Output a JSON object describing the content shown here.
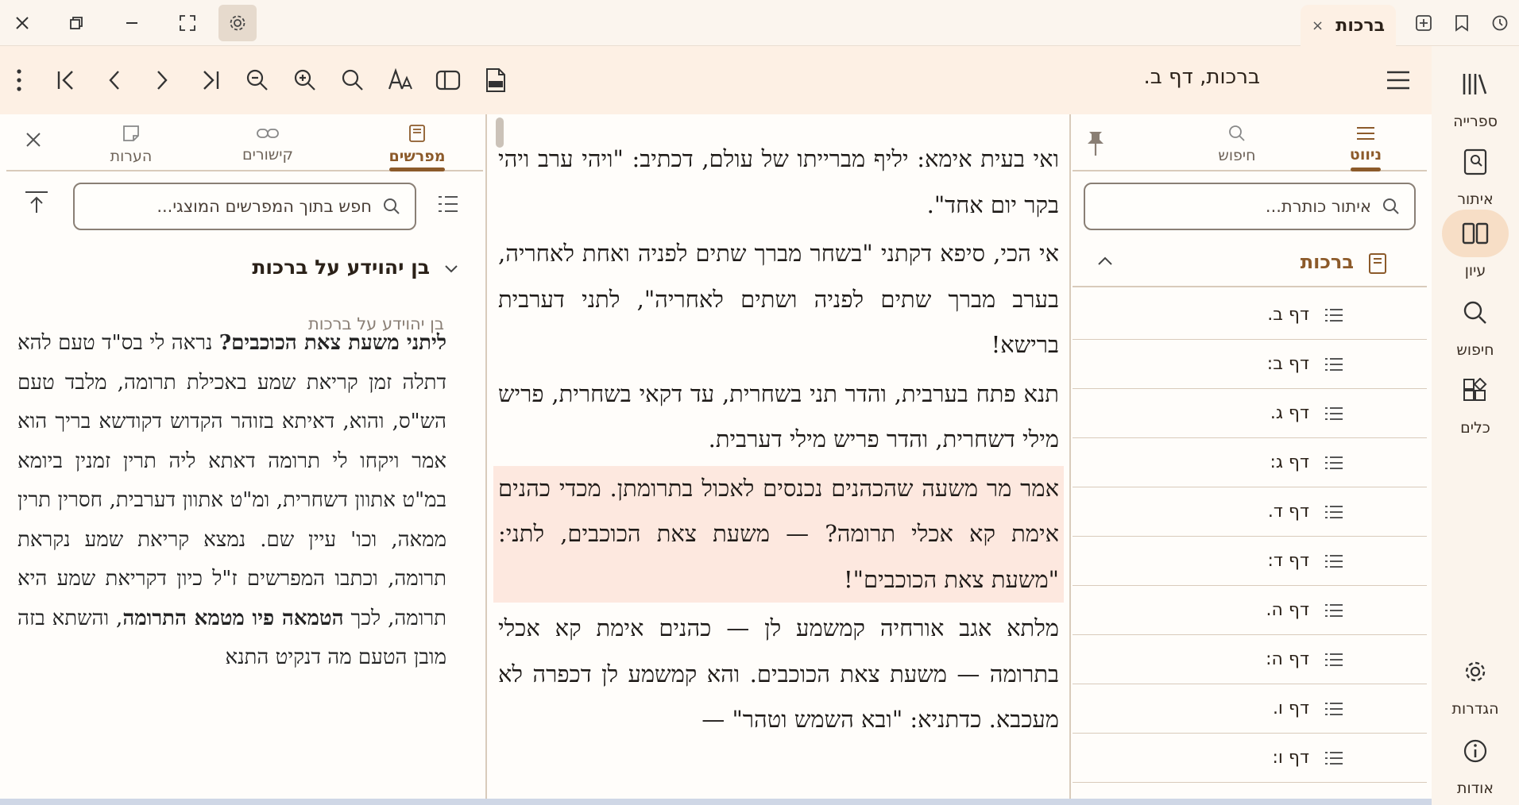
{
  "tab": {
    "title": "ברכות",
    "close": "×"
  },
  "toolbar": {
    "title": "ברכות, דף ב."
  },
  "rail": {
    "library": "ספרייה",
    "locate": "איתור",
    "study": "עיון",
    "search": "חיפוש",
    "tools": "כלים",
    "settings": "הגדרות",
    "about": "אודות"
  },
  "left_pane": {
    "tabs": [
      "מפרשים",
      "קישורים",
      "הערות"
    ],
    "search_placeholder": "חפש בתוך המפרשים המוצגי...",
    "group_title": "בן יהוידע על ברכות",
    "group_subtitle": "בן יהוידע על ברכות",
    "commentary_bold1": "ליתני משעת צאת הכוכבים?",
    "commentary_text1": " נראה לי בס\"ד טעם להא דתלה זמן קריאת שמע באכילת תרומה, מלבד טעם הש\"ס, והוא, דאיתא בזוהר הקדוש דקודשא בריך הוא אמר ויקחו לי תרומה דאתא ליה תרין זמנין ביומא במ\"ט אתוון דשחרית, ומ\"ט אתוון דערבית, חסרין תרין ממאה, וכו' עיין שם. נמצא קריאת שמע נקראת תרומה, וכתבו המפרשים ז\"ל כיון דקריאת שמע היא תרומה, לכך ",
    "commentary_bold2": "הטמאה פיו מטמא התרומה",
    "commentary_text2": ", והשתא בזה מובן הטעם מה דנקיט התנא"
  },
  "main_text": {
    "paragraphs": [
      "ואי בעית אימא: יליף מברייתו של עולם, דכתיב: \"ויהי ערב ויהי בקר יום אחד\".",
      "אי הכי, סיפא דקתני \"בשחר מברך שתים לפניה ואחת לאחריה, בערב מברך שתים לפניה ושתים לאחריה\", לתני דערבית ברישא!",
      "תנא פתח בערבית, והדר תני בשחרית, עד דקאי בשחרית, פריש מילי דשחרית, והדר פריש מילי דערבית.",
      "אמר מר משעה שהכהנים נכנסים לאכול בתרומתן. מכדי כהנים אימת קא אכלי תרומה? — משעת צאת הכוכבים, לתני: \"משעת צאת הכוכבים\"!",
      "מלתא אגב אורחיה קמשמע לן — כהנים אימת קא אכלי בתרומה — משעת צאת הכוכבים. והא קמשמע לן דכפרה לא מעכבא. כדתניא: \"ובא השמש וטהר\" —"
    ]
  },
  "right_pane": {
    "tabs": [
      "ניווט",
      "חיפוש"
    ],
    "search_placeholder": "איתור כותרת...",
    "book": "ברכות",
    "toc": [
      "דף ב.",
      "דף ב:",
      "דף ג.",
      "דף ג:",
      "דף ד.",
      "דף ד:",
      "דף ה.",
      "דף ה:",
      "דף ו.",
      "דף ו:"
    ]
  },
  "colors": {
    "accent": "#8c5a2a",
    "highlight": "#fde8df",
    "toolbar_bg": "#fdf0e4"
  }
}
